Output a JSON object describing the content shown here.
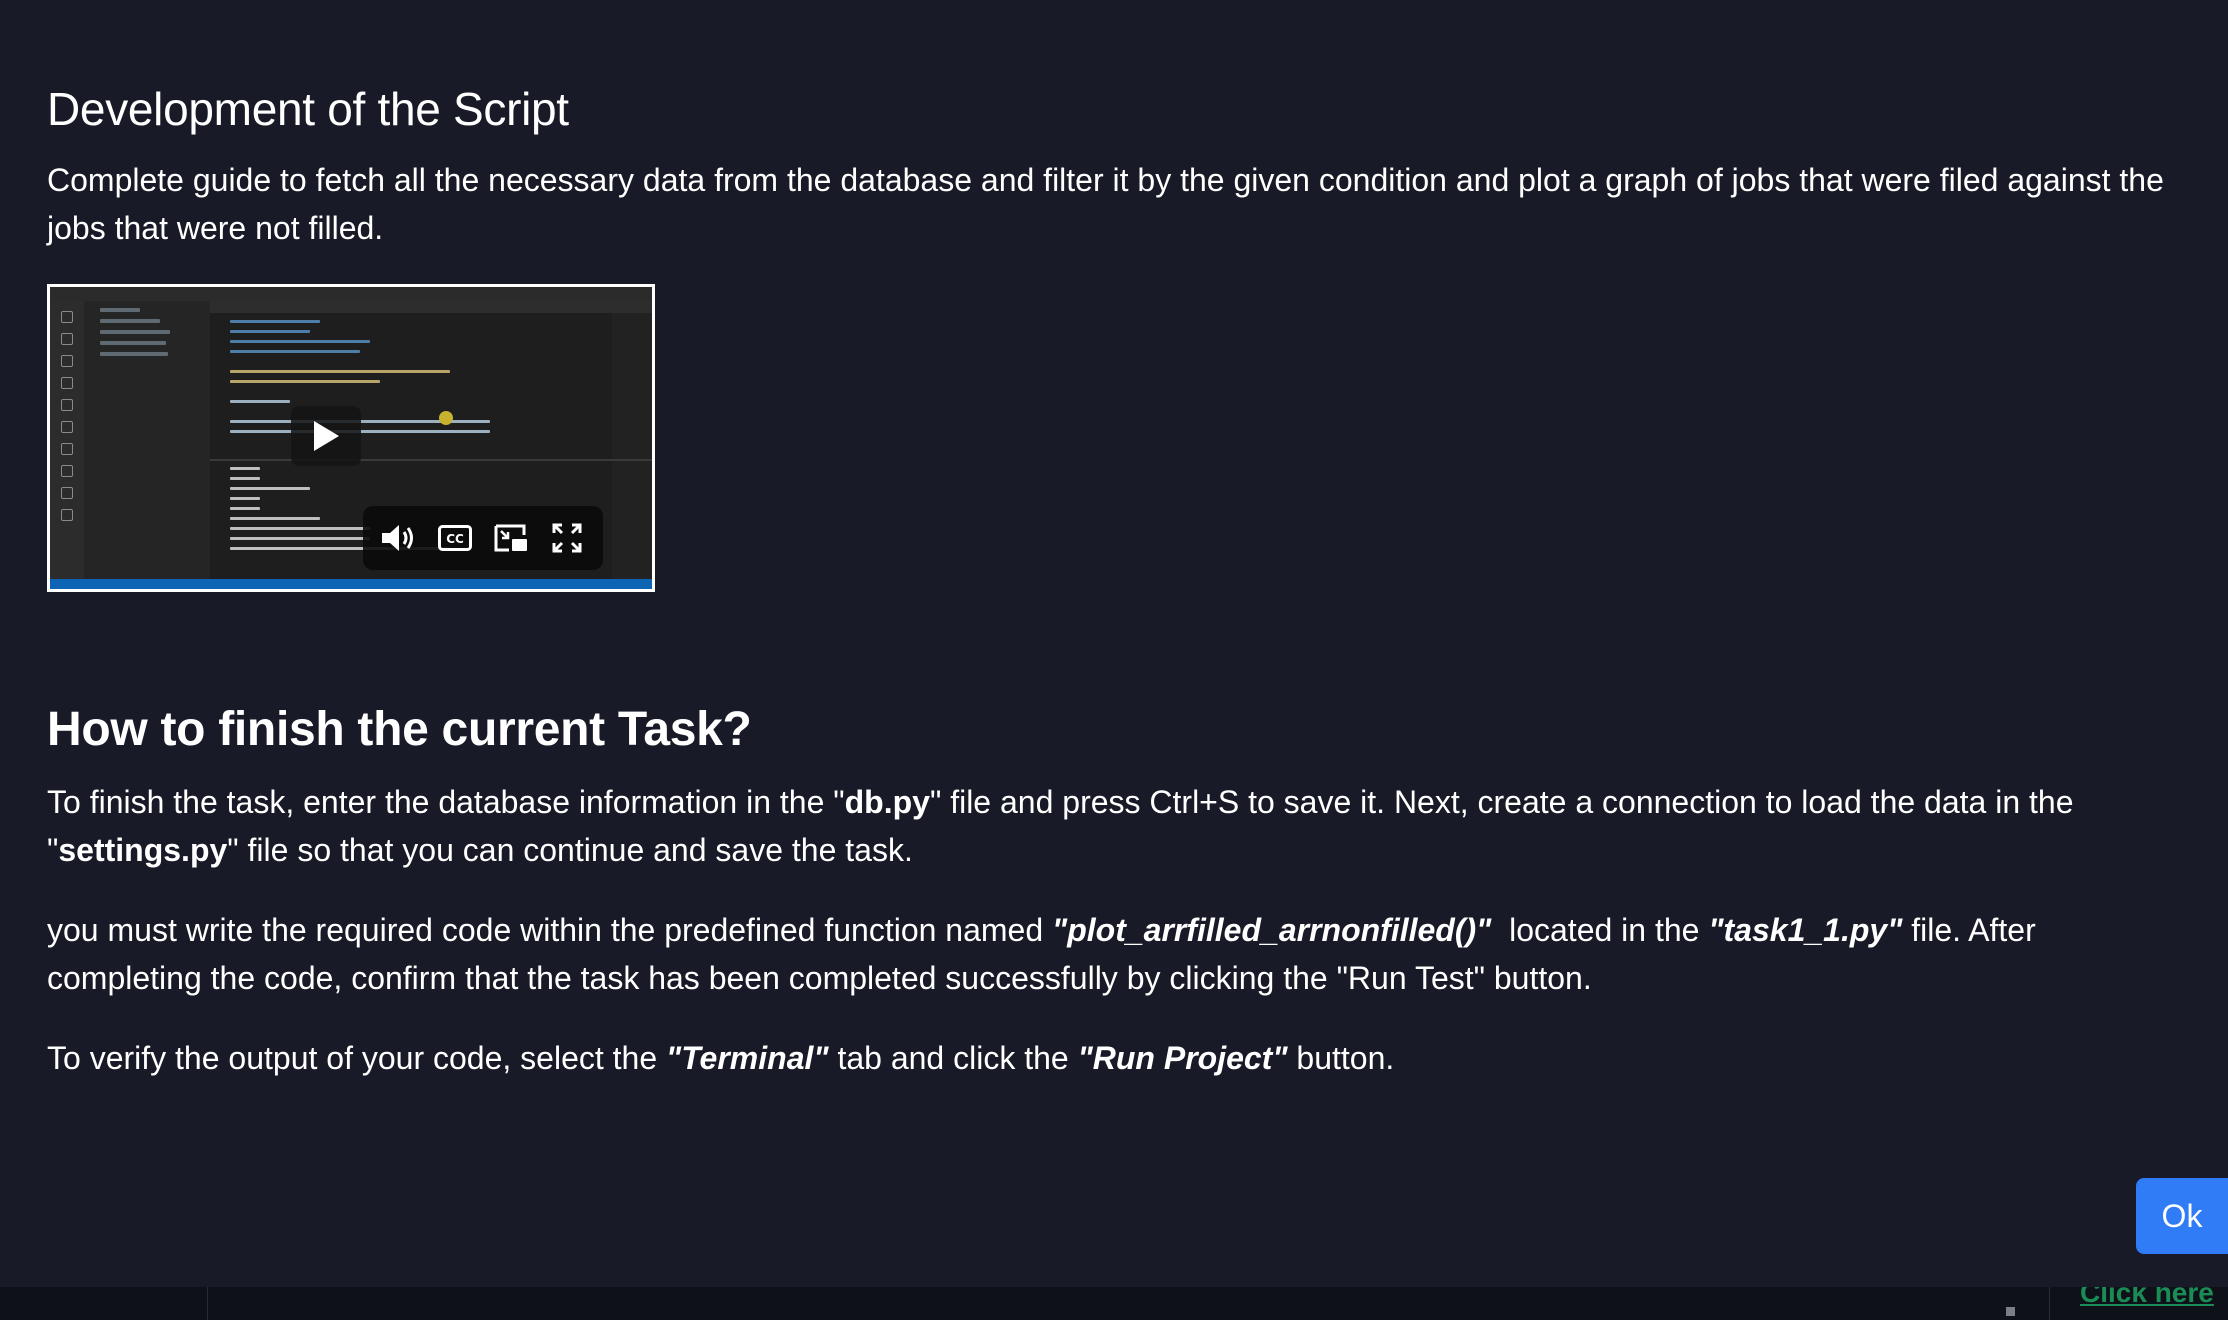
{
  "section1": {
    "title": "Development of the Script",
    "description": "Complete guide to fetch all the necessary data from the database and filter it by the given condition and plot a graph of jobs that were filed against the jobs that were not filled."
  },
  "video": {
    "play_icon": "play-icon",
    "controls": [
      "volume-icon",
      "closed-captions-icon",
      "picture-in-picture-icon",
      "fullscreen-icon"
    ]
  },
  "section2": {
    "title": "How to finish the current Task?",
    "p1": {
      "t1": "To finish the task, enter the database information in the \"",
      "b1": "db.py",
      "t2": "\" file and press Ctrl+S to save it. Next, create a connection to load the data in the \"",
      "b2": "settings.py",
      "t3": "\" file so that you can continue and save the task."
    },
    "p2": {
      "t1": "you must write the required code within the predefined function named ",
      "bi1": "\"plot_arrfilled_arrnonfilled()\"",
      "t2": "  located in the ",
      "bi2": "\"task1_1.py\"",
      "t3": " file. After completing the code, confirm that the task has been completed successfully by clicking the \"Run Test\" button."
    },
    "p3": {
      "t1": "To verify the output of your code, select the ",
      "bi1": "\"Terminal\"",
      "t2": " tab and click the ",
      "bi2": "\"Run Project\"",
      "t3": " button."
    }
  },
  "ok_button": "Ok",
  "footer": {
    "link": "Click here"
  },
  "colors": {
    "background": "#181b27",
    "accent": "#2f7cf6",
    "link": "#1c8c57"
  }
}
